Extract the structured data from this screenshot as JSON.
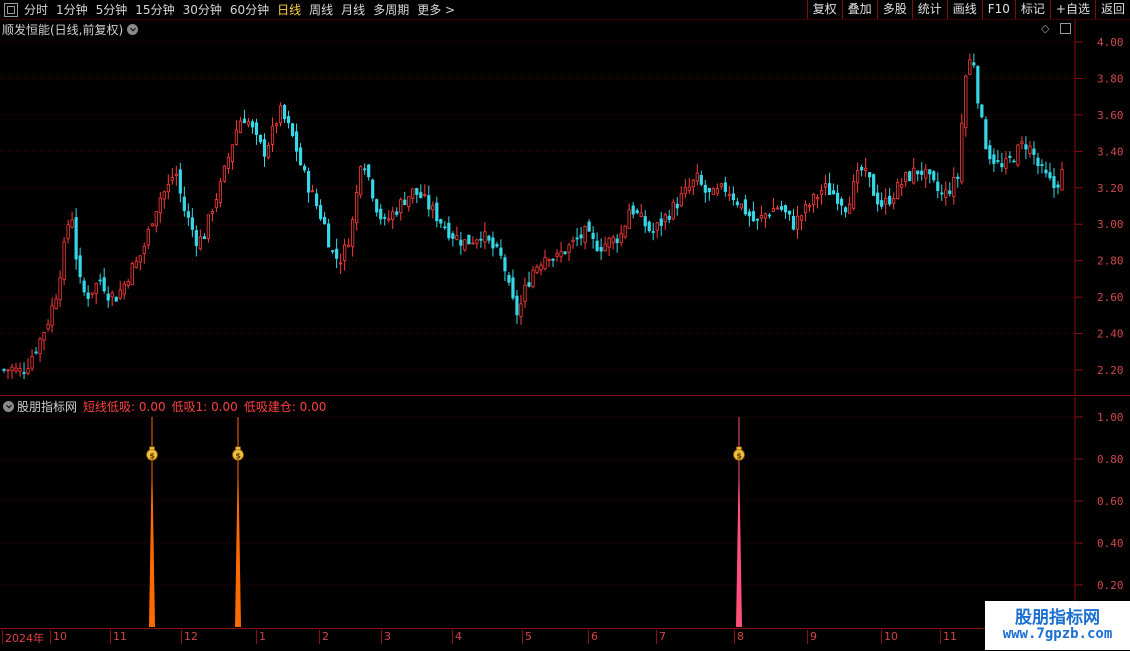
{
  "toolbar": {
    "periods": [
      "分时",
      "1分钟",
      "5分钟",
      "15分钟",
      "30分钟",
      "60分钟",
      "日线",
      "周线",
      "月线",
      "多周期",
      "更多 >"
    ],
    "active_period": "日线",
    "right_buttons": [
      "复权",
      "叠加",
      "多股",
      "统计",
      "画线",
      "F10",
      "标记",
      "+自选",
      "返回"
    ]
  },
  "main_panel": {
    "title": "顺发恒能(日线,前复权)",
    "y_axis_labels": [
      "4.00",
      "3.80",
      "3.60",
      "3.40",
      "3.20",
      "3.00",
      "2.80",
      "2.60",
      "2.40",
      "2.20"
    ]
  },
  "indicator_panel": {
    "name": "股朋指标网",
    "items": [
      {
        "label": "短线低吸:",
        "value": "0.00"
      },
      {
        "label": "低吸1:",
        "value": "0.00"
      },
      {
        "label": "低吸建仓:",
        "value": "0.00"
      }
    ],
    "y_axis_labels": [
      "1.00",
      "0.80",
      "0.60",
      "0.40",
      "0.20"
    ]
  },
  "time_axis": [
    "2024年",
    "10",
    "11",
    "12",
    "1",
    "2",
    "3",
    "4",
    "5",
    "6",
    "7",
    "8",
    "9",
    "10",
    "11"
  ],
  "watermark": {
    "line1": "股朋指标网",
    "line2": "www.7gpzb.com"
  },
  "colors": {
    "up": "#ff3c3c",
    "down": "#36d7e6",
    "grid": "#5a0000",
    "axis": "#8c1010",
    "signal_orange": "#ff6a00",
    "signal_pink": "#ff4f7a",
    "label_red": "#e04040",
    "signal_text": "#ff4040"
  },
  "chart_data": [
    {
      "type": "candlestick",
      "title": "顺发恒能(日线,前复权)",
      "ylim": [
        2.1,
        4.05
      ],
      "close_profile": [
        2.2,
        2.21,
        2.19,
        2.22,
        2.3,
        2.38,
        2.48,
        2.62,
        2.85,
        3.1,
        2.7,
        2.6,
        2.65,
        2.7,
        2.62,
        2.6,
        2.66,
        2.75,
        2.8,
        2.9,
        3.05,
        3.15,
        3.2,
        3.3,
        3.1,
        3.0,
        2.9,
        2.95,
        3.1,
        3.2,
        3.35,
        3.5,
        3.6,
        3.55,
        3.45,
        3.4,
        3.5,
        3.62,
        3.55,
        3.45,
        3.3,
        3.2,
        3.1,
        3.0,
        2.85,
        2.8,
        2.88,
        3.05,
        3.4,
        3.25,
        3.1,
        3.0,
        3.05,
        3.1,
        3.15,
        3.18,
        3.15,
        3.1,
        3.05,
        3.0,
        2.95,
        2.92,
        2.9,
        2.92,
        2.95,
        2.9,
        2.85,
        2.8,
        2.6,
        2.5,
        2.65,
        2.75,
        2.8,
        2.85,
        2.8,
        2.85,
        2.88,
        2.92,
        2.95,
        2.9,
        2.88,
        2.9,
        2.92,
        2.95,
        3.1,
        3.05,
        3.0,
        2.95,
        3.0,
        3.05,
        3.1,
        3.15,
        3.2,
        3.25,
        3.18,
        3.15,
        3.18,
        3.2,
        3.15,
        3.1,
        3.05,
        3.0,
        3.05,
        3.08,
        3.1,
        3.05,
        3.0,
        3.05,
        3.1,
        3.15,
        3.2,
        3.18,
        3.15,
        3.1,
        3.2,
        3.3,
        3.25,
        3.15,
        3.1,
        3.15,
        3.2,
        3.25,
        3.28,
        3.3,
        3.25,
        3.2,
        3.15,
        3.2,
        3.25,
        3.8,
        3.95,
        3.6,
        3.4,
        3.35,
        3.3,
        3.35,
        3.4,
        3.45,
        3.4,
        3.3,
        3.25,
        3.2,
        3.28
      ],
      "high_max": 4.0,
      "low_min": 2.15
    },
    {
      "type": "bar",
      "title": "股朋指标网",
      "ylim": [
        0,
        1.05
      ],
      "series": [
        {
          "name": "短线低吸",
          "value": 0.0
        },
        {
          "name": "低吸1",
          "value": 0.0
        },
        {
          "name": "低吸建仓",
          "value": 0.0
        }
      ],
      "signals": [
        {
          "x_label": "11",
          "value": 1.0,
          "color": "orange"
        },
        {
          "x_label": "12",
          "value": 1.0,
          "color": "orange"
        },
        {
          "x_label": "8",
          "value": 1.0,
          "color": "pink"
        }
      ]
    }
  ]
}
